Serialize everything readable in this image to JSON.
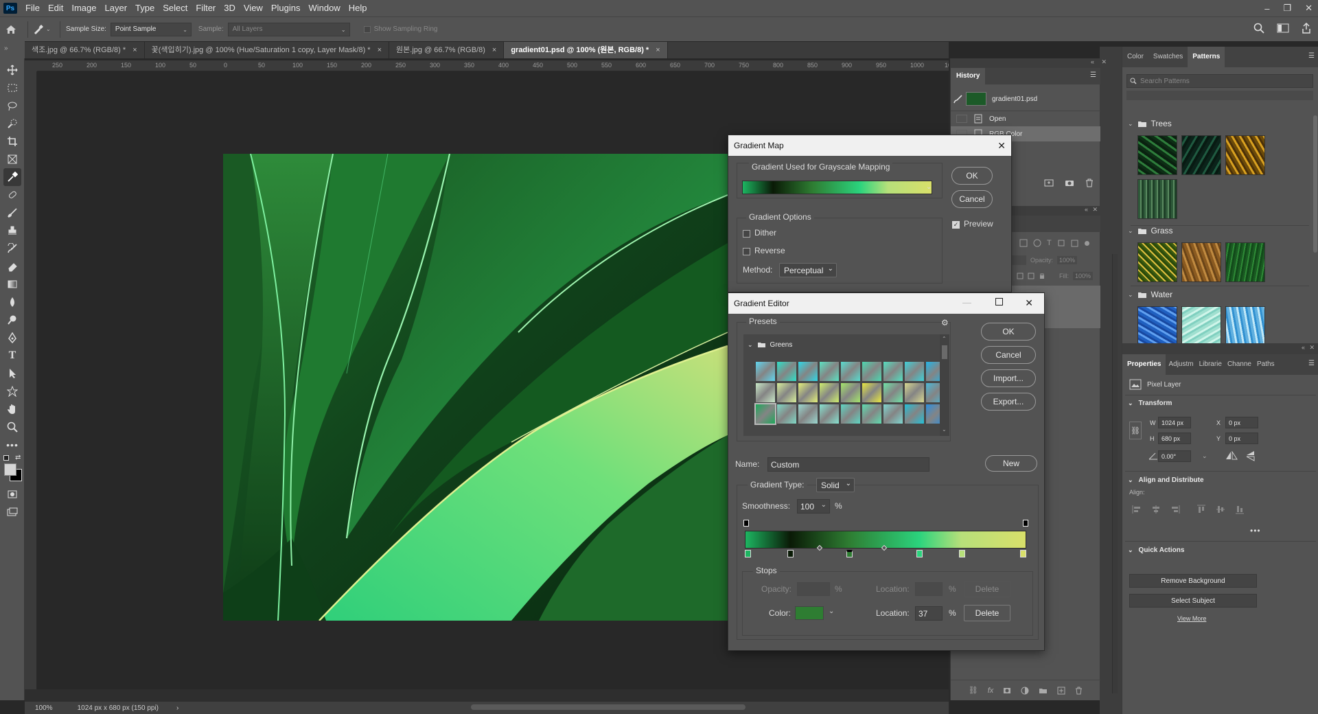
{
  "app": {
    "logo_text": "Ps",
    "menu": [
      "File",
      "Edit",
      "Image",
      "Layer",
      "Type",
      "Select",
      "Filter",
      "3D",
      "View",
      "Plugins",
      "Window",
      "Help"
    ],
    "window_controls": [
      "–",
      "❐",
      "✕"
    ]
  },
  "options_bar": {
    "sample_size_label": "Sample Size:",
    "sample_size_value": "Point Sample",
    "sample_label": "Sample:",
    "sample_value": "All Layers",
    "show_sampling_ring": "Show Sampling Ring"
  },
  "doc_tabs": [
    {
      "label": "색조.jpg @ 66.7% (RGB/8) *",
      "active": false
    },
    {
      "label": "꽃(색입히기).jpg @ 100% (Hue/Saturation 1 copy, Layer Mask/8) *",
      "active": false
    },
    {
      "label": "원본.jpg @ 66.7% (RGB/8)",
      "active": false
    },
    {
      "label": "gradient01.psd @ 100% (원본, RGB/8) *",
      "active": true
    }
  ],
  "ruler_h": [
    "250",
    "200",
    "150",
    "100",
    "50",
    "0",
    "50",
    "100",
    "150",
    "200",
    "250",
    "300",
    "350",
    "400",
    "450",
    "500",
    "550",
    "600",
    "650",
    "700",
    "750",
    "800",
    "850",
    "900",
    "950",
    "1000",
    "1050"
  ],
  "status_bar": {
    "zoom": "100%",
    "doc_info": "1024 px x 680 px (150 ppi)",
    "arrow": "›"
  },
  "history_panel": {
    "title": "History",
    "snapshot": "gradient01.psd",
    "items": [
      "Open",
      "RGB Color"
    ]
  },
  "layers_panel": {
    "opacity_label": "Opacity:",
    "opacity_value": "100%",
    "fill_label": "Fill:",
    "fill_value": "100%"
  },
  "right_tabs": [
    "Color",
    "Swatches",
    "Patterns"
  ],
  "patterns": {
    "search_placeholder": "Search Patterns",
    "groups": [
      {
        "name": "Trees",
        "count": 4
      },
      {
        "name": "Grass",
        "count": 3
      },
      {
        "name": "Water",
        "count": 3
      }
    ]
  },
  "properties": {
    "tabs": [
      "Properties",
      "Adjustm",
      "Librarie",
      "Channe",
      "Paths"
    ],
    "layer_type": "Pixel Layer",
    "transform_title": "Transform",
    "w_label": "W",
    "w_value": "1024 px",
    "h_label": "H",
    "h_value": "680 px",
    "x_label": "X",
    "x_value": "0 px",
    "y_label": "Y",
    "y_value": "0 px",
    "angle_value": "0.00°",
    "align_title": "Align and Distribute",
    "align_label": "Align:",
    "quick_title": "Quick Actions",
    "remove_bg": "Remove Background",
    "select_subject": "Select Subject",
    "view_more": "View More"
  },
  "gradient_map": {
    "title": "Gradient Map",
    "group_label": "Gradient Used for Grayscale Mapping",
    "options_label": "Gradient Options",
    "dither": "Dither",
    "reverse": "Reverse",
    "method_label": "Method:",
    "method_value": "Perceptual",
    "ok": "OK",
    "cancel": "Cancel",
    "preview": "Preview",
    "preview_checked": true
  },
  "gradient_editor": {
    "title": "Gradient Editor",
    "presets_label": "Presets",
    "folder_name": "Greens",
    "ok": "OK",
    "cancel": "Cancel",
    "import": "Import...",
    "export": "Export...",
    "name_label": "Name:",
    "name_value": "Custom",
    "new": "New",
    "type_label": "Gradient Type:",
    "type_value": "Solid",
    "smooth_label": "Smoothness:",
    "smooth_value": "100",
    "percent": "%",
    "stops_label": "Stops",
    "opacity_label": "Opacity:",
    "location_label": "Location:",
    "color_label": "Color:",
    "color_location": "37",
    "delete": "Delete",
    "color_swatch": "#2e7d32",
    "gradient_stops": [
      {
        "pos": 0,
        "color": "#1db561"
      },
      {
        "pos": 16,
        "color": "#0a1a06"
      },
      {
        "pos": 37,
        "color": "#2e7d32"
      },
      {
        "pos": 62,
        "color": "#2bd37d"
      },
      {
        "pos": 77,
        "color": "#b7e07a"
      },
      {
        "pos": 100,
        "color": "#d9e06a"
      }
    ],
    "preset_colors": [
      [
        "#5fd6f0",
        "#2ee0c8",
        "#2fd8e6",
        "#5ce2c2",
        "#58dccf",
        "#4cd8b0",
        "#54dfc0",
        "#3fd0d8",
        "#22b5e8"
      ],
      [
        "#c9e8c7",
        "#d8ef9a",
        "#e3f07a",
        "#cfef6e",
        "#a5e66b",
        "#e8e840",
        "#6fe2a7",
        "#d8d890",
        "#4cb8d8"
      ],
      [
        "#1da85a",
        "#7fd9c6",
        "#9ad8d0",
        "#86e2d0",
        "#5ed6c3",
        "#5fdcb0",
        "#7fd6d0",
        "#23c0d8",
        "#2b8fe0"
      ]
    ]
  }
}
